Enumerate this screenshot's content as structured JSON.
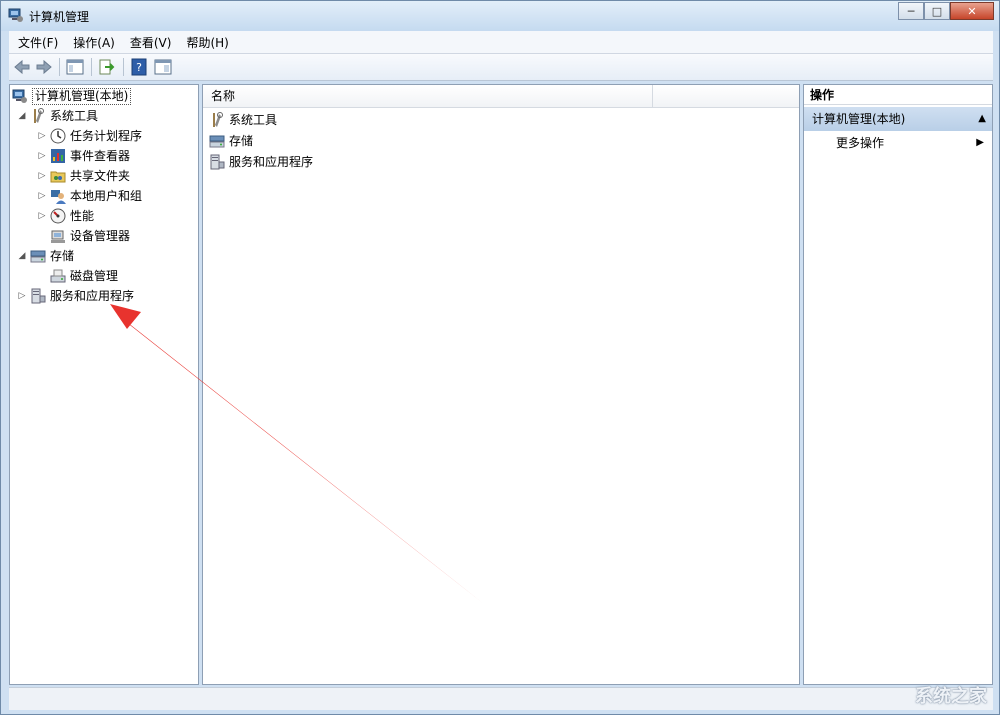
{
  "window": {
    "title": "计算机管理",
    "min_label": "─",
    "max_label": "□",
    "close_label": "✕"
  },
  "menu": [
    "文件(F)",
    "操作(A)",
    "查看(V)",
    "帮助(H)"
  ],
  "tree": [
    {
      "label": "计算机管理(本地)",
      "icon": "computer-management-icon",
      "expander": ""
    },
    {
      "label": "系统工具",
      "icon": "system-tools-icon",
      "expander": "◢"
    },
    {
      "label": "任务计划程序",
      "icon": "task-scheduler-icon",
      "expander": "▷"
    },
    {
      "label": "事件查看器",
      "icon": "event-viewer-icon",
      "expander": "▷"
    },
    {
      "label": "共享文件夹",
      "icon": "shared-folders-icon",
      "expander": "▷"
    },
    {
      "label": "本地用户和组",
      "icon": "local-users-icon",
      "expander": "▷"
    },
    {
      "label": "性能",
      "icon": "performance-icon",
      "expander": "▷"
    },
    {
      "label": "设备管理器",
      "icon": "device-manager-icon",
      "expander": ""
    },
    {
      "label": "存储",
      "icon": "storage-icon",
      "expander": "◢"
    },
    {
      "label": "磁盘管理",
      "icon": "disk-management-icon",
      "expander": ""
    },
    {
      "label": "服务和应用程序",
      "icon": "services-apps-icon",
      "expander": "▷"
    }
  ],
  "list": {
    "column_name": "名称",
    "items": [
      {
        "label": "系统工具",
        "icon": "system-tools-icon"
      },
      {
        "label": "存储",
        "icon": "storage-icon"
      },
      {
        "label": "服务和应用程序",
        "icon": "services-apps-icon"
      }
    ]
  },
  "actions": {
    "header": "操作",
    "section": "计算机管理(本地)",
    "more": "更多操作",
    "section_arrow": "▲",
    "more_arrow": "▶"
  },
  "watermark": "系统之家",
  "colors": {
    "arrow": "#e8332e",
    "title_bar": "#cfe0f2",
    "selection": "#c3d7ee"
  }
}
